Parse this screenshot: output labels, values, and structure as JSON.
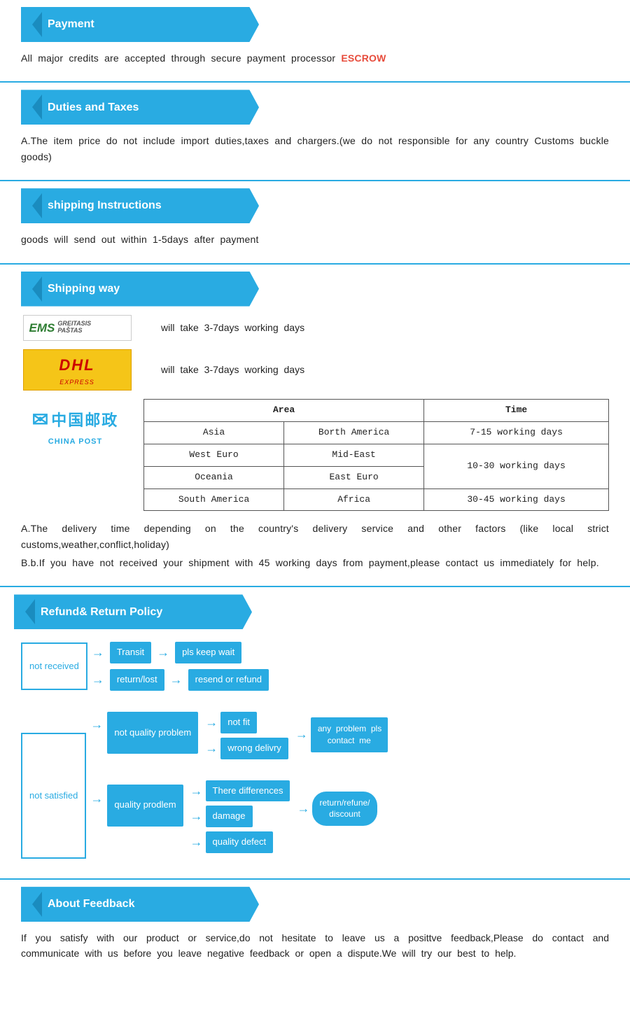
{
  "sections": {
    "payment": {
      "header": "Payment",
      "text_before": "All  major  credits  are  accepted  through  secure  payment  processor",
      "escrow": "ESCROW"
    },
    "duties": {
      "header": "Duties  and  Taxes",
      "text": "A.The  item  price  do  not  include  import  duties,taxes  and  chargers.(we  do  not  responsible  for  any  country  Customs  buckle  goods)"
    },
    "shipping_instructions": {
      "header": "shipping  Instructions",
      "text": "goods  will  send  out  within  1-5days  after  payment"
    },
    "shipping_way": {
      "header": "Shipping  way",
      "ems_text": "will  take  3-7days  working  days",
      "dhl_text": "will  take  3-7days  working  days",
      "table": {
        "col1": "Area",
        "col2": "",
        "col3": "Time",
        "rows": [
          {
            "c1": "Asia",
            "c2": "Borth America",
            "c3": "7-15 working days"
          },
          {
            "c1": "West Euro",
            "c2": "Mid-East",
            "c3": "10-30 working days"
          },
          {
            "c1": "Oceania",
            "c2": "East Euro",
            "c3": ""
          },
          {
            "c1": "South America",
            "c2": "Africa",
            "c3": "30-45 working days"
          }
        ]
      },
      "note_a": "A.The  delivery  time  depending  on  the  country's  delivery  service  and  other  factors  (like  local  strict   customs,weather,conflict,holiday)",
      "note_b": "B.b.If  you  have  not  received  your  shipment  with  45  working  days  from  payment,please  contact  us   immediately  for  help."
    },
    "refund": {
      "header": "Refund&  Return  Policy",
      "not_received": "not  received",
      "transit": "Transit",
      "return_lost": "return/lost",
      "pls_keep_wait": "pls  keep  wait",
      "resend_or_refund": "resend  or  refund",
      "not_satisfied": "not  satisfied",
      "not_quality_problem": "not  quality  problem",
      "not_fit": "not  fit",
      "wrong_delivry": "wrong  delivry",
      "quality_prodlem": "quality  prodlem",
      "there_differences": "There  differences",
      "damage": "damage",
      "quality_defect": "quality  defect",
      "any_problem": "any  problem  pls\ncontact  me",
      "return_refune_discount": "return/refune/\ndiscount"
    },
    "feedback": {
      "header": "About  Feedback",
      "text": "If  you  satisfy  with  our  product  or  service,do  not  hesitate  to  leave  us  a  posittve  feedback,Please  do  contact  and  communicate  with  us  before  you  leave  negative  feedback  or  open  a  dispute.We  will  try  our  best  to  help."
    }
  },
  "colors": {
    "blue": "#29abe2",
    "red": "#e74c3c",
    "dark_blue": "#1a8cbf"
  }
}
